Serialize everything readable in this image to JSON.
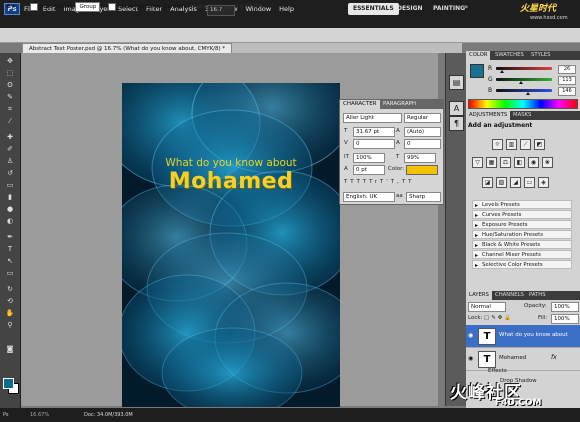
{
  "menubar": {
    "logo": "Ps",
    "items": [
      "File",
      "Edit",
      "Image",
      "Layer",
      "Select",
      "Filter",
      "Analysis",
      "3D",
      "View",
      "Window",
      "Help"
    ],
    "zoom": "16.7",
    "workspaces": [
      "ESSENTIALS",
      "DESIGN",
      "PAINTING"
    ],
    "chevron": "»",
    "watermark": "火星时代",
    "watermark_url": "www.hxsd.com"
  },
  "options_bar": {
    "auto_select_label": "Auto-Select:",
    "auto_select_value": "Group",
    "show_transform_label": "Show Transform Controls"
  },
  "document": {
    "tab_title": "Abstract Text Poster.psd @ 16.7% (What do you know about, CMYK/8) *",
    "status": "Doc: 34.0M/393.0M",
    "zoom_status": "16.67%"
  },
  "poster": {
    "tagline": "What do you know about",
    "name": "Mohamed"
  },
  "character_panel": {
    "tabs": [
      "CHARACTER",
      "PARAGRAPH"
    ],
    "font_family": "Aller Light",
    "font_style": "Regular",
    "font_size": "31.67 pt",
    "leading": "(Auto)",
    "kerning": "0",
    "tracking": "0",
    "vertical_scale": "100%",
    "horizontal_scale": "99%",
    "baseline": "0 pt",
    "color_label": "Color:",
    "style_buttons": [
      "T",
      "T",
      "TT",
      "Tr",
      "T'",
      "T,",
      "T",
      "T"
    ],
    "language": "English: UK",
    "antialias": "Sharp",
    "text_color": "#f2c200"
  },
  "color_panel": {
    "tabs": [
      "COLOR",
      "SWATCHES",
      "STYLES"
    ],
    "channels": [
      {
        "label": "R",
        "value": "26",
        "fill": 0.1,
        "color": "#e04040"
      },
      {
        "label": "G",
        "value": "113",
        "fill": 0.44,
        "color": "#30b030"
      },
      {
        "label": "B",
        "value": "146",
        "fill": 0.57,
        "color": "#3050e0"
      }
    ],
    "foreground": "#1a7192"
  },
  "adjustments_panel": {
    "tabs": [
      "ADJUSTMENTS",
      "MASKS"
    ],
    "title": "Add an adjustment",
    "presets": [
      "Levels Presets",
      "Curves Presets",
      "Exposure Presets",
      "Hue/Saturation Presets",
      "Black & White Presets",
      "Channel Mixer Presets",
      "Selective Color Presets"
    ]
  },
  "layers_panel": {
    "tabs": [
      "LAYERS",
      "CHANNELS",
      "PATHS"
    ],
    "blend_mode": "Normal",
    "opacity_label": "Opacity:",
    "opacity": "100%",
    "lock_label": "Lock:",
    "fill_label": "Fill:",
    "fill": "100%",
    "layers": [
      {
        "name": "What do you know about",
        "thumb": "T",
        "fx": ""
      },
      {
        "name": "Mohamed",
        "thumb": "T",
        "fx": "fx"
      }
    ],
    "effects_label": "Effects",
    "drop_shadow": "Drop Shadow"
  },
  "watermark_bottom": {
    "text": "火峰社区",
    "url": "F4D.COM"
  }
}
